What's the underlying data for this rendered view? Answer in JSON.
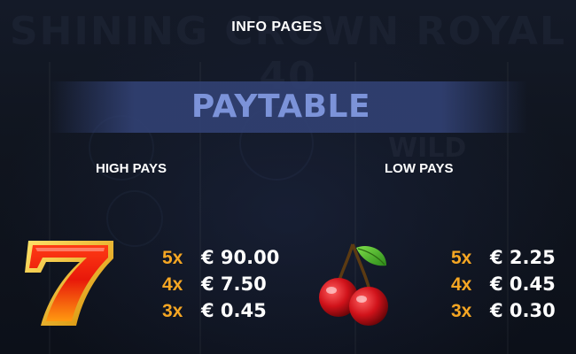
{
  "header": {
    "title": "INFO PAGES"
  },
  "banner": {
    "title": "PAYTABLE"
  },
  "background": {
    "game_title": "SHINING CROWN ROYAL 40",
    "wild": "WILD"
  },
  "sections": {
    "high_pays": {
      "heading": "HIGH PAYS",
      "symbol_icon": "lucky-seven-icon",
      "pays": [
        {
          "mult": "5x",
          "amount": "€ 90.00"
        },
        {
          "mult": "4x",
          "amount": "€ 7.50"
        },
        {
          "mult": "3x",
          "amount": "€ 0.45"
        }
      ]
    },
    "low_pays": {
      "heading": "LOW PAYS",
      "symbol_icon": "cherry-icon",
      "pays": [
        {
          "mult": "5x",
          "amount": "€ 2.25"
        },
        {
          "mult": "4x",
          "amount": "€ 0.45"
        },
        {
          "mult": "3x",
          "amount": "€ 0.30"
        }
      ]
    }
  },
  "colors": {
    "background": "#0f1420",
    "banner": "#303f70",
    "banner_text": "#7c93d9",
    "multiplier": "#f5a623",
    "amount": "#ffffff"
  }
}
